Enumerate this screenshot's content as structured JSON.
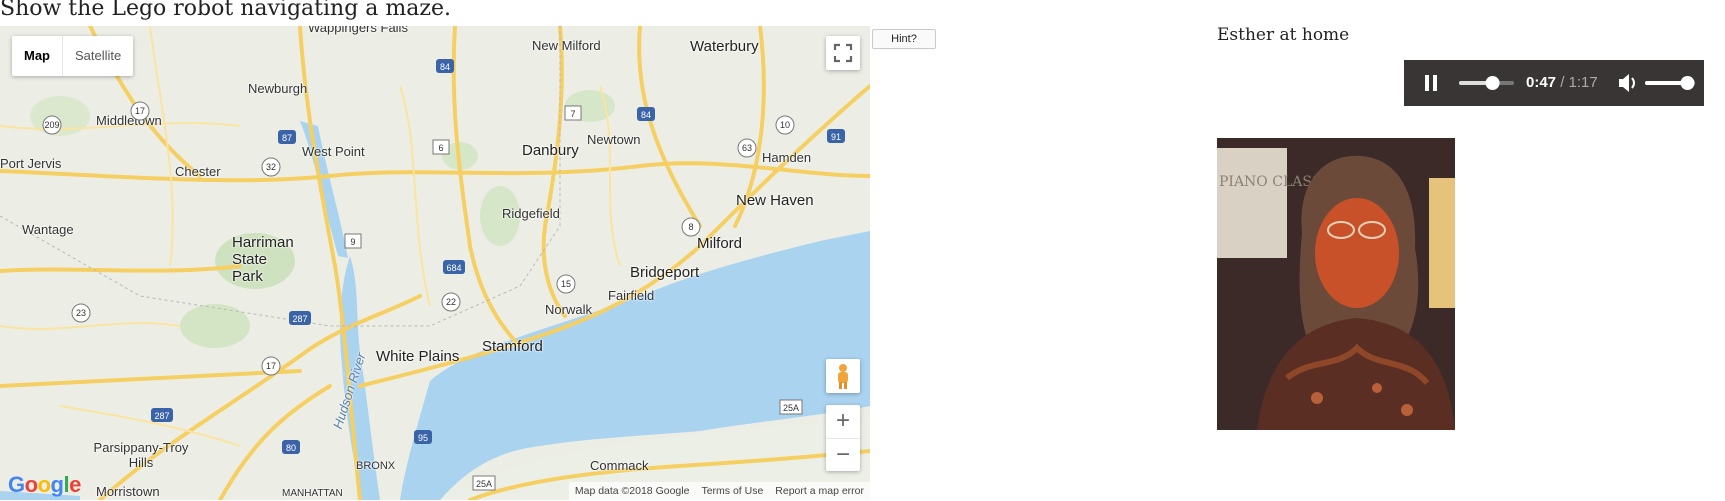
{
  "prompt": "Show the Lego robot navigating a maze.",
  "hint_button": "Hint?",
  "map": {
    "type_buttons": {
      "map": "Map",
      "satellite": "Satellite"
    },
    "labels": [
      "Wappingers Falls",
      "New Milford",
      "Waterbury",
      "Newburgh",
      "Middletown",
      "West Point",
      "Danbury",
      "Newtown",
      "Hamden",
      "Port Jervis",
      "Chester",
      "Ridgefield",
      "New Haven",
      "Wantage",
      "Harriman State Park",
      "Milford",
      "Bridgeport",
      "Fairfield",
      "Norwalk",
      "White Plains",
      "Stamford",
      "Hudson River",
      "Parsippany-Troy Hills",
      "Morristown",
      "BRONX",
      "Commack",
      "MANHATTAN"
    ],
    "shields": [
      "84",
      "17",
      "209",
      "87",
      "6",
      "7",
      "84",
      "63",
      "10",
      "91",
      "32",
      "9",
      "684",
      "8",
      "22",
      "287",
      "23",
      "17",
      "287",
      "95",
      "80",
      "25A",
      "25A",
      "15"
    ],
    "zoom_in": "+",
    "zoom_out": "−",
    "logo": "Google",
    "attribution": [
      "Map data ©2018 Google",
      "Terms of Use",
      "Report a map error"
    ]
  },
  "panel": {
    "caption": "Esther at home",
    "audio": {
      "current_time": "0:47",
      "separator": " / ",
      "duration": "1:17",
      "progress": 0.61,
      "volume": 0.85
    },
    "photo_text": "PIANO CLASSICS"
  },
  "colors": {
    "water": "#aad3f0",
    "land": "#eef0ea",
    "roads": "#f7d26e",
    "player_bg": "#3a3535"
  }
}
